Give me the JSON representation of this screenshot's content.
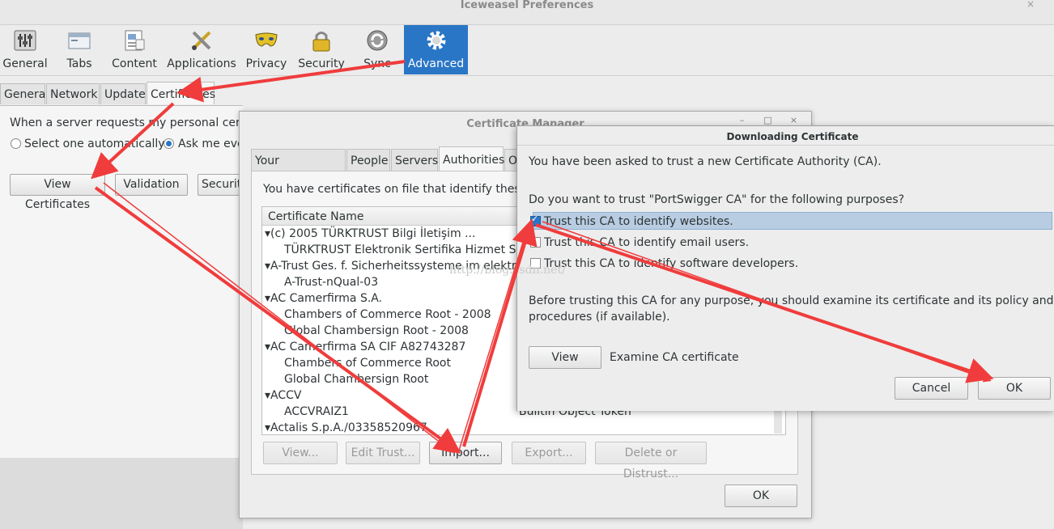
{
  "window": {
    "title": "Iceweasel Preferences",
    "close_glyph": "×"
  },
  "toolbar": {
    "items": [
      {
        "label": "General",
        "icon": "sliders-icon"
      },
      {
        "label": "Tabs",
        "icon": "tabs-icon"
      },
      {
        "label": "Content",
        "icon": "content-icon"
      },
      {
        "label": "Applications",
        "icon": "applications-icon"
      },
      {
        "label": "Privacy",
        "icon": "mask-icon"
      },
      {
        "label": "Security",
        "icon": "lock-icon"
      },
      {
        "label": "Sync",
        "icon": "sync-icon"
      },
      {
        "label": "Advanced",
        "icon": "gear-icon",
        "selected": true
      }
    ]
  },
  "advanced_tabs": [
    "General",
    "Network",
    "Update",
    "Certificates"
  ],
  "prefs": {
    "server_request_text": "When a server requests my personal certific",
    "radio_auto": "Select one automatically",
    "radio_ask": "Ask me eve",
    "view_certificates": "View Certificates",
    "validation": "Validation",
    "security_devices": "Securit"
  },
  "cert_manager": {
    "title": "Certificate Manager",
    "window_buttons": [
      "–",
      "□",
      "×"
    ],
    "tabs": [
      "Your Certificates",
      "People",
      "Servers",
      "Authorities",
      "O"
    ],
    "description": "You have certificates on file that identify these c",
    "column_name": "Certificate Name",
    "rows": [
      {
        "name": "▾(c) 2005 TÜRKTRUST Bilgi İletişim ...",
        "device": ""
      },
      {
        "name": "TÜRKTRUST Elektronik Sertifika Hizmet S...",
        "device": "",
        "child": true
      },
      {
        "name": "▾A-Trust Ges. f. Sicherheitssysteme im elektr...",
        "device": ""
      },
      {
        "name": "A-Trust-nQual-03",
        "device": "",
        "child": true
      },
      {
        "name": "▾AC Camerfirma S.A.",
        "device": ""
      },
      {
        "name": "Chambers of Commerce Root - 2008",
        "device": "",
        "child": true
      },
      {
        "name": "Global Chambersign Root - 2008",
        "device": "",
        "child": true
      },
      {
        "name": "▾AC Camerfirma SA CIF A82743287",
        "device": ""
      },
      {
        "name": "Chambers of Commerce Root",
        "device": "",
        "child": true
      },
      {
        "name": "Global Chambersign Root",
        "device": "",
        "child": true
      },
      {
        "name": "▾ACCV",
        "device": ""
      },
      {
        "name": "ACCVRAIZ1",
        "device": "Builtin Object Token",
        "child": true
      },
      {
        "name": "▾Actalis S.p.A./03358520967",
        "device": ""
      }
    ],
    "buttons": {
      "view": "View...",
      "edit_trust": "Edit Trust...",
      "import": "Import...",
      "export": "Export...",
      "delete": "Delete or Distrust..."
    },
    "ok": "OK"
  },
  "download_dialog": {
    "title": "Downloading Certificate",
    "intro": "You have been asked to trust a new Certificate Authority (CA).",
    "question": "Do you want to trust \"PortSwigger CA\" for the following purposes?",
    "options": [
      {
        "label": "Trust this CA to identify websites.",
        "checked": true
      },
      {
        "label": "Trust this CA to identify email users.",
        "checked": false
      },
      {
        "label": "Trust this CA to identify software developers.",
        "checked": false
      }
    ],
    "advice_line1": "Before trusting this CA for any purpose, you should examine its certificate and its policy and",
    "advice_line2": "procedures (if available).",
    "view_button": "View",
    "examine_label": "Examine CA certificate",
    "cancel": "Cancel",
    "ok": "OK"
  },
  "watermark": "http://blog.csdn.net/",
  "colors": {
    "accent": "#2a76c6",
    "arrow": "#f03c3c"
  }
}
